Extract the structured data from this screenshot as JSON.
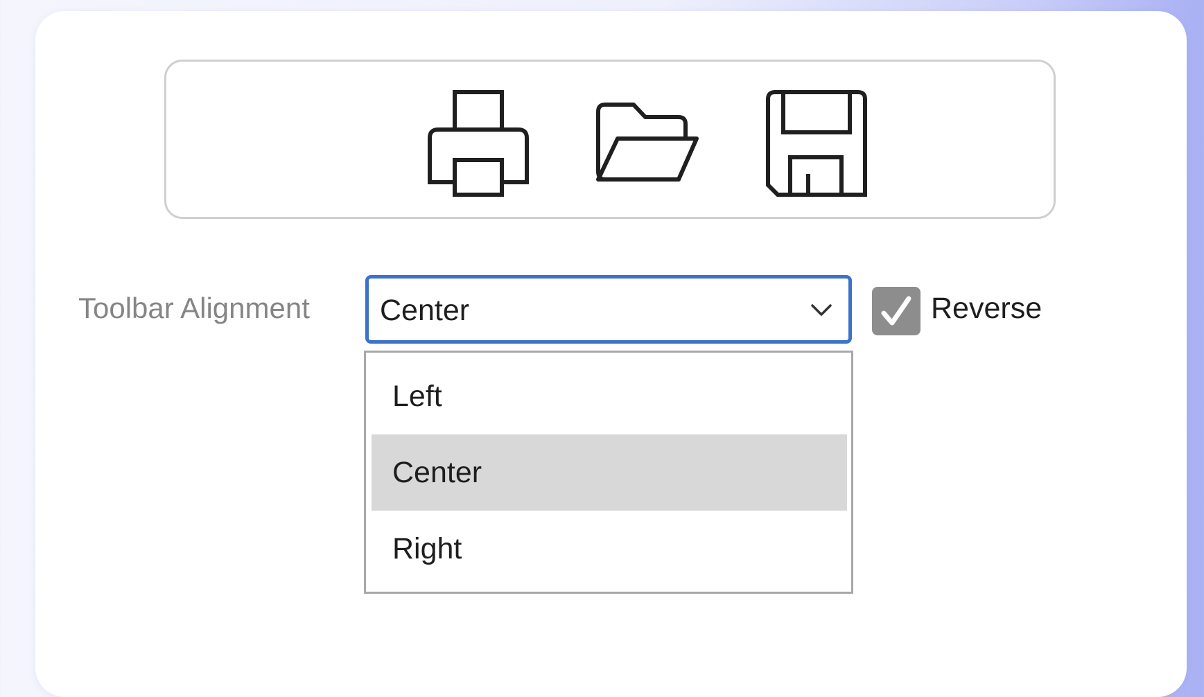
{
  "toolbar": {
    "buttons": [
      {
        "icon": "print-icon"
      },
      {
        "icon": "folder-open-icon"
      },
      {
        "icon": "save-icon"
      }
    ]
  },
  "settings": {
    "alignment_label": "Toolbar Alignment",
    "alignment_value": "Center",
    "alignment_options": [
      "Left",
      "Center",
      "Right"
    ],
    "reverse_label": "Reverse",
    "reverse_checked": true
  },
  "colors": {
    "focus_border": "#3c72c9",
    "checkbox_fill": "#8d8d8d",
    "option_highlight": "#d8d8d8"
  }
}
